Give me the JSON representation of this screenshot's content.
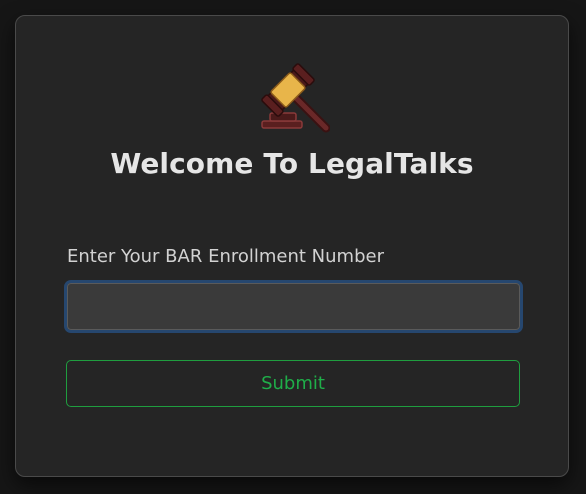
{
  "logo": {
    "icon": "gavel-icon"
  },
  "title": "Welcome To LegalTalks",
  "form": {
    "label": "Enter Your BAR Enrollment Number",
    "input_value": "",
    "input_placeholder": "",
    "submit_label": "Submit"
  },
  "colors": {
    "background": "#161616",
    "card": "#252525",
    "input_focus_ring": "#26476f",
    "submit_accent": "#1fae49"
  }
}
